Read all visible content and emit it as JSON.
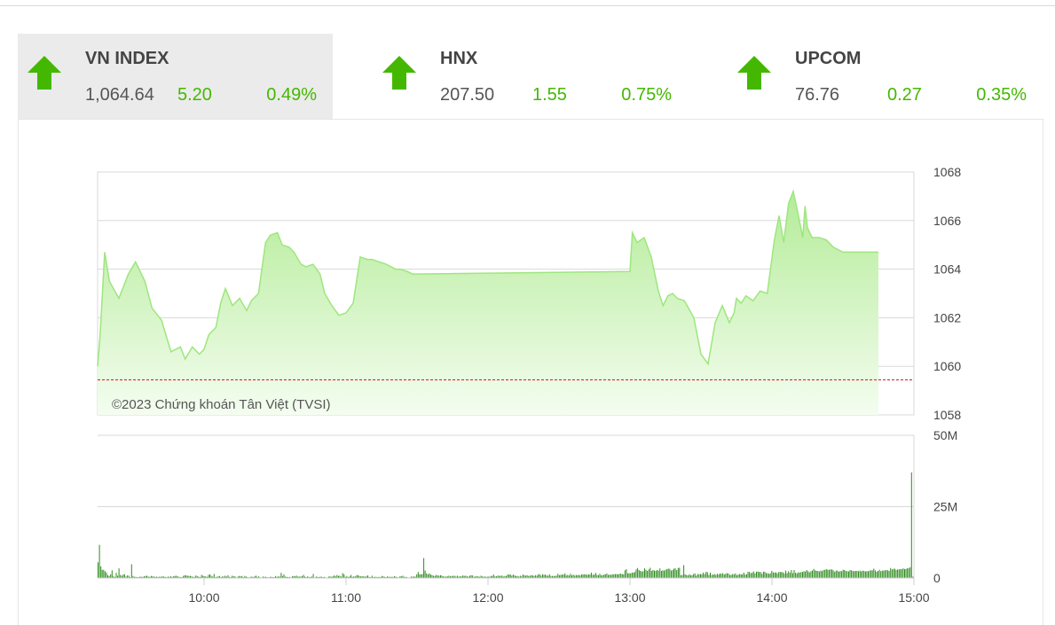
{
  "indices": [
    {
      "name": "VN INDEX",
      "value": "1,064.64",
      "change": "5.20",
      "percent": "0.49%",
      "direction": "up",
      "active": true
    },
    {
      "name": "HNX",
      "value": "207.50",
      "change": "1.55",
      "percent": "0.75%",
      "direction": "up",
      "active": false
    },
    {
      "name": "UPCOM",
      "value": "76.76",
      "change": "0.27",
      "percent": "0.35%",
      "direction": "up",
      "active": false
    }
  ],
  "colors": {
    "up": "#44b800",
    "line": "#9ee67e",
    "fill_top": "#b4ec98",
    "fill_bottom": "#f4fdf0",
    "reference": "#cc2020",
    "volume": "#2e8b1e"
  },
  "chart_data": {
    "type": "area",
    "copyright": "©2023 Chứng khoán Tân Việt (TVSI)",
    "price": {
      "ylim": [
        1058,
        1068
      ],
      "yticks": [
        "1068",
        "1066",
        "1064",
        "1062",
        "1060",
        "1058"
      ],
      "reference": 1059.44,
      "x": [
        "09:15",
        "09:16",
        "09:18",
        "09:20",
        "09:24",
        "09:28",
        "09:31",
        "09:35",
        "09:38",
        "09:42",
        "09:46",
        "09:50",
        "09:52",
        "09:55",
        "09:58",
        "10:00",
        "10:02",
        "10:05",
        "10:07",
        "10:09",
        "10:12",
        "10:15",
        "10:18",
        "10:20",
        "10:23",
        "10:26",
        "10:28",
        "10:31",
        "10:33",
        "10:36",
        "10:38",
        "10:41",
        "10:43",
        "10:46",
        "10:49",
        "10:51",
        "10:54",
        "10:57",
        "11:00",
        "11:03",
        "11:06",
        "11:09",
        "11:11",
        "11:14",
        "11:17",
        "11:19",
        "11:21",
        "11:23",
        "11:26",
        "11:28",
        "11:29",
        "11:30",
        "13:00",
        "13:01",
        "13:03",
        "13:06",
        "13:09",
        "13:12",
        "13:14",
        "13:16",
        "13:18",
        "13:20",
        "13:23",
        "13:27",
        "13:30",
        "13:33",
        "13:36",
        "13:39",
        "13:42",
        "13:44",
        "13:45",
        "13:47",
        "13:49",
        "13:52",
        "13:55",
        "13:58",
        "14:01",
        "14:03",
        "14:05",
        "14:07",
        "14:09",
        "14:11",
        "14:13",
        "14:14",
        "14:15",
        "14:17",
        "14:18",
        "14:20",
        "14:23",
        "14:26",
        "14:30",
        "14:45"
      ],
      "y": [
        1060.0,
        1061.2,
        1064.7,
        1063.5,
        1062.8,
        1063.8,
        1064.3,
        1063.5,
        1062.4,
        1061.9,
        1060.6,
        1060.8,
        1060.3,
        1060.8,
        1060.5,
        1060.7,
        1061.3,
        1061.6,
        1062.6,
        1063.2,
        1062.5,
        1062.8,
        1062.3,
        1062.7,
        1063.0,
        1065.1,
        1065.4,
        1065.5,
        1065.0,
        1064.9,
        1064.7,
        1064.2,
        1064.1,
        1064.2,
        1063.8,
        1063.0,
        1062.5,
        1062.1,
        1062.2,
        1062.6,
        1064.5,
        1064.4,
        1064.4,
        1064.3,
        1064.2,
        1064.1,
        1064.0,
        1064.0,
        1063.9,
        1063.8,
        1063.8,
        1063.8,
        1063.9,
        1065.5,
        1065.1,
        1065.3,
        1064.5,
        1063.1,
        1062.5,
        1062.9,
        1063.0,
        1062.8,
        1062.7,
        1062.0,
        1060.5,
        1060.1,
        1061.8,
        1062.5,
        1061.8,
        1062.2,
        1062.8,
        1062.6,
        1062.9,
        1062.7,
        1063.1,
        1063.0,
        1065.2,
        1066.2,
        1065.1,
        1066.7,
        1067.2,
        1066.3,
        1065.3,
        1066.6,
        1065.7,
        1065.3,
        1065.3,
        1065.3,
        1065.2,
        1064.9,
        1064.7,
        1064.7
      ]
    },
    "volume": {
      "ylim": [
        0,
        50
      ],
      "yticks": [
        "50M",
        "25M",
        "0"
      ],
      "x_start": "09:15",
      "values": [
        5.5,
        11.6,
        4.1,
        2.9,
        2.9,
        2.4,
        1.9,
        1.0,
        0.7,
        1.3,
        2.7,
        0.6,
        0.4,
        1.8,
        0.8,
        3.4,
        1.1,
        0.8,
        1.2,
        1.3,
        0.5,
        0.9,
        0.8,
        0.3,
        4.8,
        0.7,
        0.4,
        0.4,
        0.3,
        0.3,
        0.5,
        0.4,
        0.4,
        0.6,
        0.7,
        0.8,
        0.5,
        0.4,
        0.7,
        0.6,
        0.5,
        0.4,
        0.5,
        0.3,
        0.5,
        0.4,
        0.6,
        0.5,
        0.4,
        0.3,
        0.5,
        0.4,
        0.6,
        0.4,
        0.6,
        0.7,
        0.8,
        0.6,
        0.4,
        0.3,
        0.3,
        0.7,
        1.0,
        0.9,
        0.8,
        0.7,
        0.7,
        0.6,
        0.4,
        0.4,
        0.9,
        0.6,
        0.5,
        0.3,
        1.1,
        0.8,
        0.6,
        0.6,
        0.4,
        1.1,
        1.3,
        0.8,
        0.5,
        1.4,
        0.3,
        0.4,
        0.6,
        0.7,
        0.3,
        0.6,
        0.5,
        0.8,
        0.5,
        1.0,
        0.4,
        0.3,
        0.8,
        0.6,
        0.6,
        0.2,
        0.5,
        0.7,
        0.6,
        0.7,
        0.3,
        0.7,
        0.5,
        0.3,
        0.2,
        0.4,
        0.5,
        0.3,
        0.6,
        0.8,
        0.4,
        0.6,
        0.2,
        0.2,
        0.5,
        0.4,
        0.4,
        0.3,
        0.2,
        0.4,
        0.4,
        0.3,
        0.3,
        0.7,
        0.4,
        0.6,
        0.5,
        1.8,
        0.7,
        1.3,
        0.5,
        0.4,
        0.3,
        0.4,
        0.2,
        0.6,
        0.7,
        0.6,
        0.8,
        0.5,
        0.5,
        0.5,
        0.7,
        1.1,
        0.5,
        0.3,
        0.6,
        0.3,
        0.4,
        0.5,
        1.4,
        0.2,
        0.5,
        0.4,
        0.3,
        0.5,
        0.4,
        0.3,
        0.4,
        0.2,
        0.2,
        0.5,
        0.6,
        0.4,
        0.6,
        0.9,
        0.6,
        1.1,
        0.7,
        0.8,
        0.5,
        1.7,
        1.3,
        0.4,
        0.7,
        0.3,
        0.6,
        1.1,
        0.4,
        0.6,
        0.5,
        1.0,
        1.0,
        0.7,
        0.6,
        0.6,
        0.6,
        0.5,
        0.6,
        0.9,
        0.4,
        0.3,
        0.8,
        0.3,
        0.4,
        0.4,
        0.3,
        0.4,
        0.3,
        0.7,
        0.6,
        0.4,
        0.3,
        0.6,
        0.4,
        0.4,
        0.4,
        0.4,
        0.6,
        0.5,
        0.3,
        0.2,
        0.6,
        0.6,
        0.8,
        0.4,
        0.4,
        0.3,
        0.2,
        0.2,
        0.5,
        0.5,
        0.5,
        0.5,
        1.3,
        2.1,
        1.3,
        1.3,
        1.4,
        7.0,
        2.6,
        1.6,
        1.3,
        1.6,
        1.2,
        1.0,
        0.8,
        0.7,
        1.1,
        0.9,
        0.8,
        1.0,
        0.8,
        0.6,
        0.5,
        0.5,
        0.6,
        0.8,
        0.6,
        0.7,
        0.7,
        0.8,
        0.5,
        0.8,
        0.5,
        0.6,
        0.6,
        0.9,
        0.7,
        0.8,
        0.6,
        0.5,
        0.8,
        1.0,
        0.9,
        0.4,
        0.6,
        0.6,
        0.6,
        0.4,
        0.8,
        0.6,
        0.4,
        0.6,
        0.3,
        0.6,
        0.4,
        0.7,
        0.7,
        1.2,
        0.6,
        0.6,
        0.8,
        0.8,
        0.7,
        0.9,
        0.5,
        0.7,
        0.7,
        1.2,
        1.2,
        1.2,
        0.8,
        1.2,
        0.9,
        0.7,
        0.7,
        0.5,
        0.8,
        0.6,
        1.2,
        1.0,
        0.8,
        1.0,
        0.7,
        0.8,
        1.0,
        0.9,
        0.7,
        1.0,
        0.8,
        1.3,
        1.3,
        0.8,
        1.3,
        1.1,
        1.2,
        0.9,
        0.8,
        1.3,
        0.7,
        0.7,
        0.7,
        0.7,
        0.8,
        1.5,
        1.0,
        1.1,
        1.2,
        1.2,
        1.6,
        0.9,
        1.1,
        0.9,
        1.5,
        0.9,
        1.2,
        0.8,
        1.1,
        1.0,
        1.1,
        0.9,
        1.3,
        1.2,
        1.3,
        1.3,
        1.1,
        1.3,
        1.2,
        1.9,
        1.1,
        1.2,
        1.8,
        1.1,
        1.0,
        1.5,
        1.0,
        1.0,
        1.2,
        1.3,
        1.6,
        1.1,
        1.2,
        1.1,
        1.3,
        1.3,
        1.4,
        1.4,
        1.2,
        1.5,
        1.5,
        1.4,
        1.3,
        2.7,
        3.1,
        1.6,
        1.7,
        1.6,
        1.9,
        1.9,
        2.1,
        3.0,
        3.5,
        2.8,
        2.5,
        2.3,
        2.4,
        3.4,
        2.9,
        2.5,
        3.0,
        3.6,
        2.5,
        2.8,
        2.6,
        2.5,
        2.8,
        2.6,
        3.4,
        2.5,
        2.7,
        2.6,
        2.9,
        3.1,
        3.3,
        3.2,
        2.6,
        2.8,
        3.3,
        3.4,
        2.8,
        3.5,
        3.6,
        1.0,
        1.1,
        4.5,
        1.3,
        1.1,
        0.9,
        1.3,
        1.0,
        1.0,
        1.4,
        1.6,
        0.8,
        1.4,
        1.3,
        1.4,
        1.3,
        1.9,
        1.4,
        2.2,
        2.0,
        1.1,
        1.9,
        1.1,
        1.2,
        1.4,
        1.1,
        1.5,
        1.2,
        1.6,
        1.5,
        1.7,
        1.2,
        1.5,
        1.7,
        1.6,
        1.1,
        1.1,
        1.4,
        1.3,
        1.6,
        1.0,
        1.2,
        1.4,
        1.3,
        1.3,
        1.9,
        1.2,
        1.3,
        2.2,
        2.1,
        1.7,
        1.9,
        2.3,
        1.6,
        2.2,
        2.3,
        2.1,
        2.1,
        1.5,
        2.2,
        2.2,
        1.7,
        1.7,
        1.5,
        1.6,
        2.5,
        2.0,
        1.9,
        2.0,
        1.6,
        2.1,
        2.1,
        2.1,
        2.0,
        1.6,
        2.6,
        1.7,
        2.4,
        1.9,
        2.8,
        1.7,
        2.8,
        1.9,
        1.6,
        2.0,
        1.9,
        2.1,
        2.1,
        2.4,
        2.3,
        2.8,
        2.4,
        2.0,
        2.4,
        2.6,
        3.2,
        2.7,
        2.5,
        2.5,
        2.3,
        2.6,
        2.4,
        2.8,
        2.9,
        3.1,
        2.9,
        2.9,
        3.0,
        3.0,
        2.7,
        2.2,
        2.6,
        2.6,
        2.2,
        2.5,
        2.4,
        2.9,
        2.8,
        2.5,
        2.4,
        2.3,
        2.8,
        2.7,
        2.5,
        2.4,
        2.5,
        2.5,
        2.4,
        2.6,
        2.3,
        2.6,
        2.5,
        2.3,
        2.4,
        2.4,
        2.6,
        2.7,
        2.7,
        3.3,
        2.7,
        2.2,
        2.5,
        2.9,
        2.4,
        2.6,
        2.6,
        2.7,
        2.8,
        2.7,
        2.5,
        3.5,
        3.0,
        3.2,
        3.3,
        2.8,
        3.0,
        3.0,
        3.1,
        3.1,
        3.4,
        3.1,
        3.2,
        3.4,
        3.5,
        3.8,
        37.0,
        0.5
      ]
    },
    "xticks": [
      "10:00",
      "11:00",
      "12:00",
      "13:00",
      "14:00",
      "15:00"
    ],
    "x_range": [
      "09:15",
      "15:00"
    ]
  }
}
